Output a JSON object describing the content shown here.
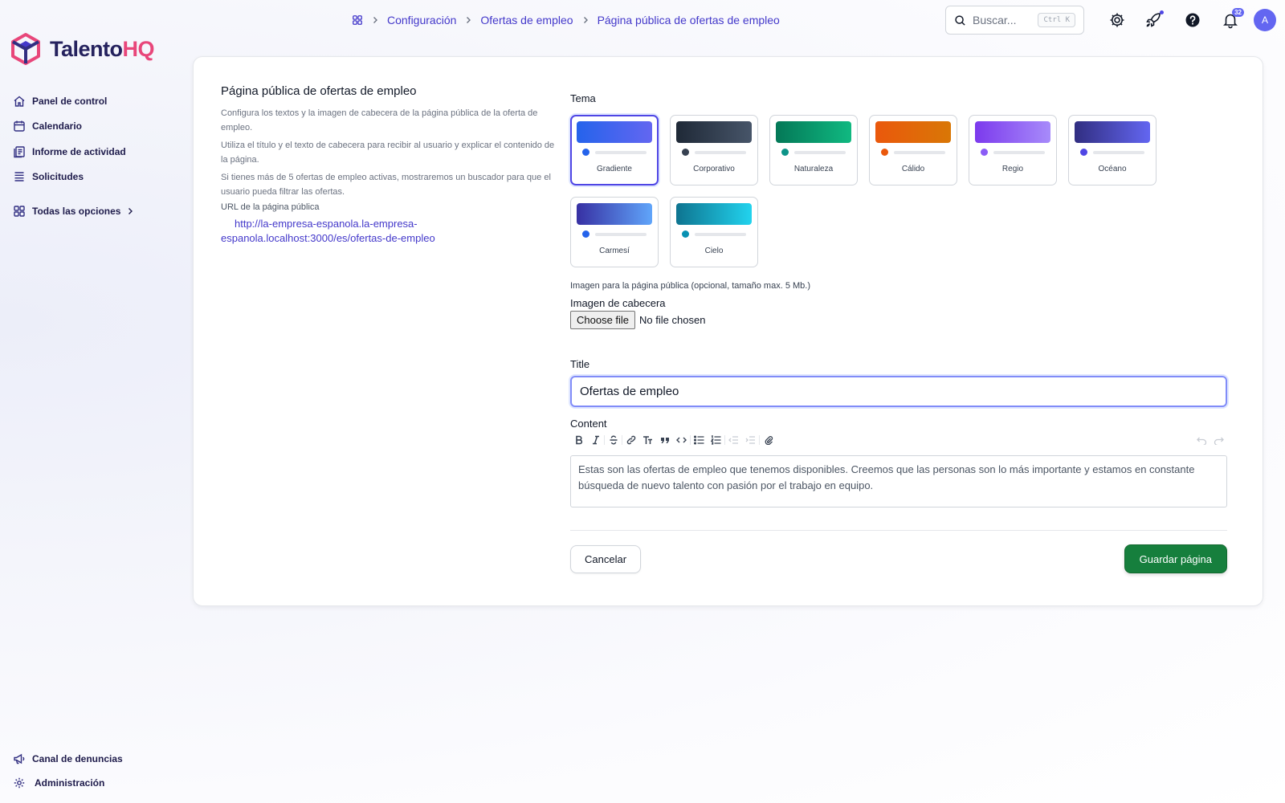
{
  "app": {
    "logo_main": "Talento",
    "logo_accent": "HQ"
  },
  "sidebar": {
    "items": [
      {
        "label": "Panel de control",
        "icon": "home-icon"
      },
      {
        "label": "Calendario",
        "icon": "calendar-icon"
      },
      {
        "label": "Informe de actividad",
        "icon": "report-icon"
      },
      {
        "label": "Solicitudes",
        "icon": "list-icon"
      }
    ],
    "all_options": "Todas las opciones",
    "bottom": [
      {
        "label": "Canal de denuncias",
        "icon": "megaphone-icon"
      },
      {
        "label": "Administración",
        "icon": "gear-icon"
      }
    ]
  },
  "breadcrumb": [
    "Configuración",
    "Ofertas de empleo",
    "Página pública de ofertas de empleo"
  ],
  "search": {
    "placeholder": "Buscar...",
    "shortcut": "Ctrl K"
  },
  "notifications": {
    "count": "32"
  },
  "user": {
    "initial": "A"
  },
  "page": {
    "title": "Página pública de ofertas de empleo",
    "desc1": "Configura los textos y la imagen de cabecera de la página pública de la oferta de empleo.",
    "desc2": "Utiliza el título y el texto de cabecera para recibir al usuario y explicar el contenido de la página.",
    "desc3": "Si tienes más de 5 ofertas de empleo activas, mostraremos un buscador para que el usuario pueda filtrar las ofertas.",
    "url_label": "URL de la página pública",
    "url": "http://la-empresa-espanola.la-empresa-espanola.localhost:3000/es/ofertas-de-empleo"
  },
  "form": {
    "theme_label": "Tema",
    "selected_theme": "Gradiente",
    "themes": [
      {
        "name": "Gradiente",
        "c1": "#2563eb",
        "c2": "#6366f1",
        "dot": "#2563eb"
      },
      {
        "name": "Corporativo",
        "c1": "#1f2937",
        "c2": "#475569",
        "dot": "#374151"
      },
      {
        "name": "Naturaleza",
        "c1": "#047857",
        "c2": "#10b981",
        "dot": "#0d9488"
      },
      {
        "name": "Cálido",
        "c1": "#ea580c",
        "c2": "#d97706",
        "dot": "#ea580c"
      },
      {
        "name": "Regio",
        "c1": "#7c3aed",
        "c2": "#a78bfa",
        "dot": "#8b5cf6"
      },
      {
        "name": "Océano",
        "c1": "#312e81",
        "c2": "#6366f1",
        "dot": "#4f46e5"
      },
      {
        "name": "Carmesí",
        "c1": "#3730a3",
        "c2": "#60a5fa",
        "dot": "#2563eb"
      },
      {
        "name": "Cielo",
        "c1": "#0e7490",
        "c2": "#22d3ee",
        "dot": "#0891b2"
      }
    ],
    "image_hint": "Imagen para la página pública (opcional, tamaño max. 5 Mb.)",
    "image_label": "Imagen de cabecera",
    "file_button": "Choose file",
    "file_status": "No file chosen",
    "title_label": "Title",
    "title_value": "Ofertas de empleo",
    "content_label": "Content",
    "content_value": "Estas son las ofertas de empleo que tenemos disponibles. Creemos que las personas son lo más importante y estamos en constante búsqueda de nuevo talento con pasión por el trabajo en equipo.",
    "cancel": "Cancelar",
    "save": "Guardar página"
  }
}
